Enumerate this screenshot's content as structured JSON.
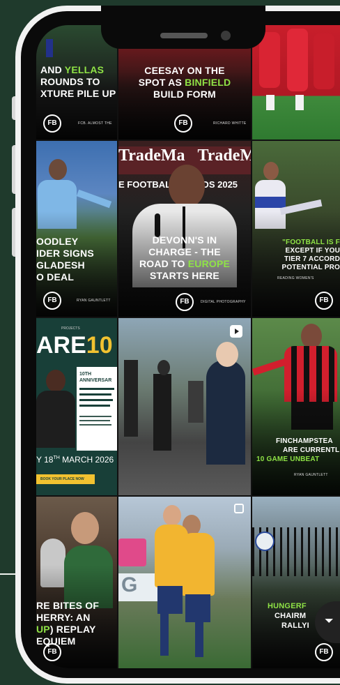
{
  "tiles": [
    {
      "headline_a": "AND ",
      "headline_g": "YELLAS",
      "headline_b": "ROUNDS TO",
      "headline_c": "XTURE PILE UP",
      "logo": "FB",
      "credit": "FCB. ALMOST THE"
    },
    {
      "headline_a": "CEESAY ON THE",
      "headline_b": "SPOT AS ",
      "headline_g": "BINFIELD",
      "headline_c": "BUILD FORM",
      "logo": "FB",
      "credit": "RICHARD WHITTE"
    },
    {
      "label": ""
    },
    {
      "headline_a": "OODLEY",
      "headline_b": "IDER SIGNS",
      "headline_c": "GLADESH",
      "headline_d": "O DEAL",
      "logo": "FB",
      "credit": "RYAN GAUNTLETT"
    },
    {
      "banner_left": "TradeMa",
      "banner_right": "TradeM",
      "awards": "E FOOTBALL",
      "awards_year": "RDS 2025",
      "headline_a": "DEVONN'S IN",
      "headline_b": "CHARGE - THE",
      "headline_c": "ROAD TO ",
      "headline_g": "EUROPE",
      "headline_d": "STARTS HERE",
      "logo": "FB",
      "credit": "DIGITAL PHOTOGRAPHY"
    },
    {
      "headline_a": "\"FOOTBALL IS F",
      "headline_b": "EXCEPT IF YOU",
      "headline_c": "TIER 7 ACCORD",
      "headline_d": "POTENTIAL PRO",
      "credit": "READING WOMEN'S",
      "logo": "FB"
    },
    {
      "top_small": "PROJECTS",
      "big_a": "ARE",
      "big_b": "10",
      "anniv_a": "10TH",
      "anniv_b": "ANNIVERSAR",
      "date": "Y 18",
      "date_sup": "TH",
      "date_b": " MARCH 2026",
      "ticket": "BOOK YOUR PLACE NOW"
    },
    {
      "label": ""
    },
    {
      "headline_a": "FINCHAMPSTEA",
      "headline_b": "ARE CURRENTL",
      "headline_g": "10 GAME UNBEAT",
      "credit": "RYAN GAUNTLETT"
    },
    {
      "headline_a": "RE BITES OF",
      "headline_b": "HERRY: AN",
      "headline_g": "UP",
      "headline_c": ") REPLAY",
      "headline_d": "EQUIEM",
      "logo": "FB"
    },
    {
      "banner": "G"
    },
    {
      "headline_g": "HUNGERF",
      "headline_a": "CHAIRM",
      "headline_b": "RALLYI",
      "logo": "FB"
    }
  ],
  "icons": {
    "reel": "reel-icon",
    "multi": "multi-image-icon",
    "filter": "filter-icon"
  },
  "colors": {
    "background": "#1f3a2c",
    "accent": "#8fe346",
    "tile_red": "#c81e2b",
    "tile_navy": "#243a8c"
  }
}
